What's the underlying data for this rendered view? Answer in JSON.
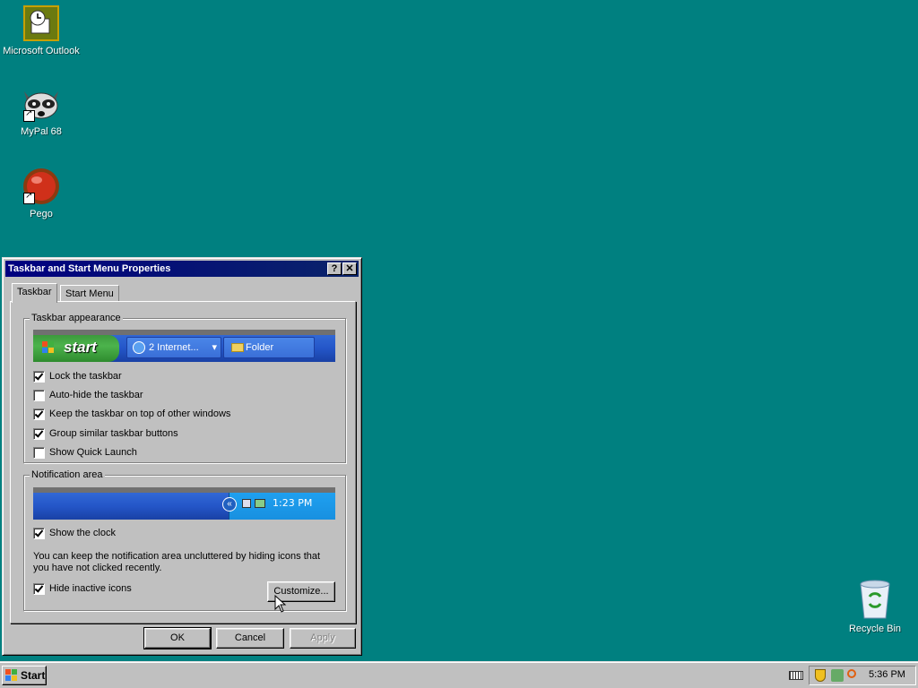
{
  "desktop": {
    "icons": [
      {
        "label": "Microsoft Outlook",
        "icon": "outlook-icon"
      },
      {
        "label": "MyPal 68",
        "icon": "mypal-raccoon-icon"
      },
      {
        "label": "Pego",
        "icon": "pego-red-ball-icon"
      },
      {
        "label": "Recycle Bin",
        "icon": "recycle-bin-icon"
      }
    ]
  },
  "dialog": {
    "title": "Taskbar and Start Menu Properties",
    "help_btn": "?",
    "close_btn": "✕",
    "tabs": [
      {
        "label": "Taskbar",
        "active": true
      },
      {
        "label": "Start Menu",
        "active": false
      }
    ],
    "appearance": {
      "title": "Taskbar appearance",
      "preview": {
        "start": "start",
        "task1": "2 Internet...",
        "task2": "Folder"
      },
      "options": [
        {
          "label": "Lock the taskbar",
          "checked": true
        },
        {
          "label": "Auto-hide the taskbar",
          "checked": false
        },
        {
          "label": "Keep the taskbar on top of other windows",
          "checked": true
        },
        {
          "label": "Group similar taskbar buttons",
          "checked": true
        },
        {
          "label": "Show Quick Launch",
          "checked": false
        }
      ]
    },
    "notification": {
      "title": "Notification area",
      "preview_clock": "1:23 PM",
      "show_clock": {
        "label": "Show the clock",
        "checked": true
      },
      "description": "You can keep the notification area uncluttered by hiding icons that you have not clicked recently.",
      "hide_inactive": {
        "label": "Hide inactive icons",
        "checked": true
      },
      "customize": "Customize..."
    },
    "buttons": {
      "ok": "OK",
      "cancel": "Cancel",
      "apply": "Apply"
    }
  },
  "taskbar": {
    "start": "Start",
    "clock": "5:36 PM",
    "tray_icons": [
      "keyboard-icon",
      "security-shield-icon",
      "network-icon",
      "search-icon"
    ]
  }
}
